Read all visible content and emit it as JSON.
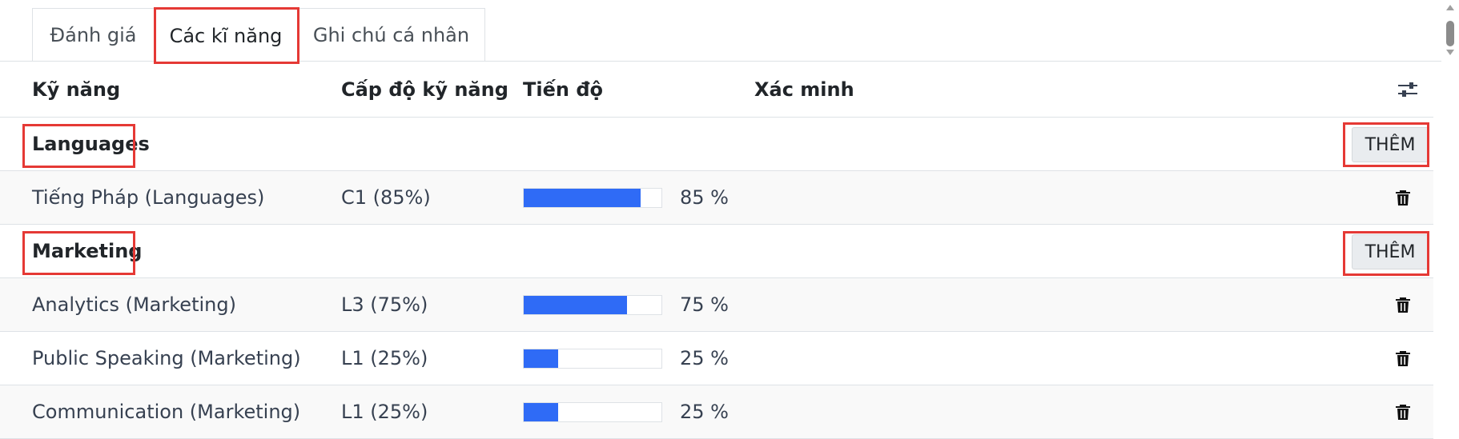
{
  "tabs": [
    {
      "label": "Đánh giá"
    },
    {
      "label": "Các kĩ năng"
    },
    {
      "label": "Ghi chú cá nhân"
    }
  ],
  "columns": {
    "skill": "Kỹ năng",
    "level": "Cấp độ kỹ năng",
    "progress": "Tiến độ",
    "verify": "Xác minh"
  },
  "groups": [
    {
      "name": "Languages",
      "add_label": "THÊM",
      "rows": [
        {
          "skill": "Tiếng Pháp (Languages)",
          "level": "C1 (85%)",
          "progress": 85,
          "progress_label": "85 %"
        }
      ]
    },
    {
      "name": "Marketing",
      "add_label": "THÊM",
      "rows": [
        {
          "skill": "Analytics (Marketing)",
          "level": "L3 (75%)",
          "progress": 75,
          "progress_label": "75 %"
        },
        {
          "skill": "Public Speaking (Marketing)",
          "level": "L1 (25%)",
          "progress": 25,
          "progress_label": "25 %"
        },
        {
          "skill": "Communication (Marketing)",
          "level": "L1 (25%)",
          "progress": 25,
          "progress_label": "25 %"
        }
      ]
    }
  ],
  "colors": {
    "progress_fill": "#2f6bf6",
    "highlight": "#e53935"
  },
  "icons": {
    "column_settings": "sliders-icon",
    "delete": "trash-icon"
  }
}
